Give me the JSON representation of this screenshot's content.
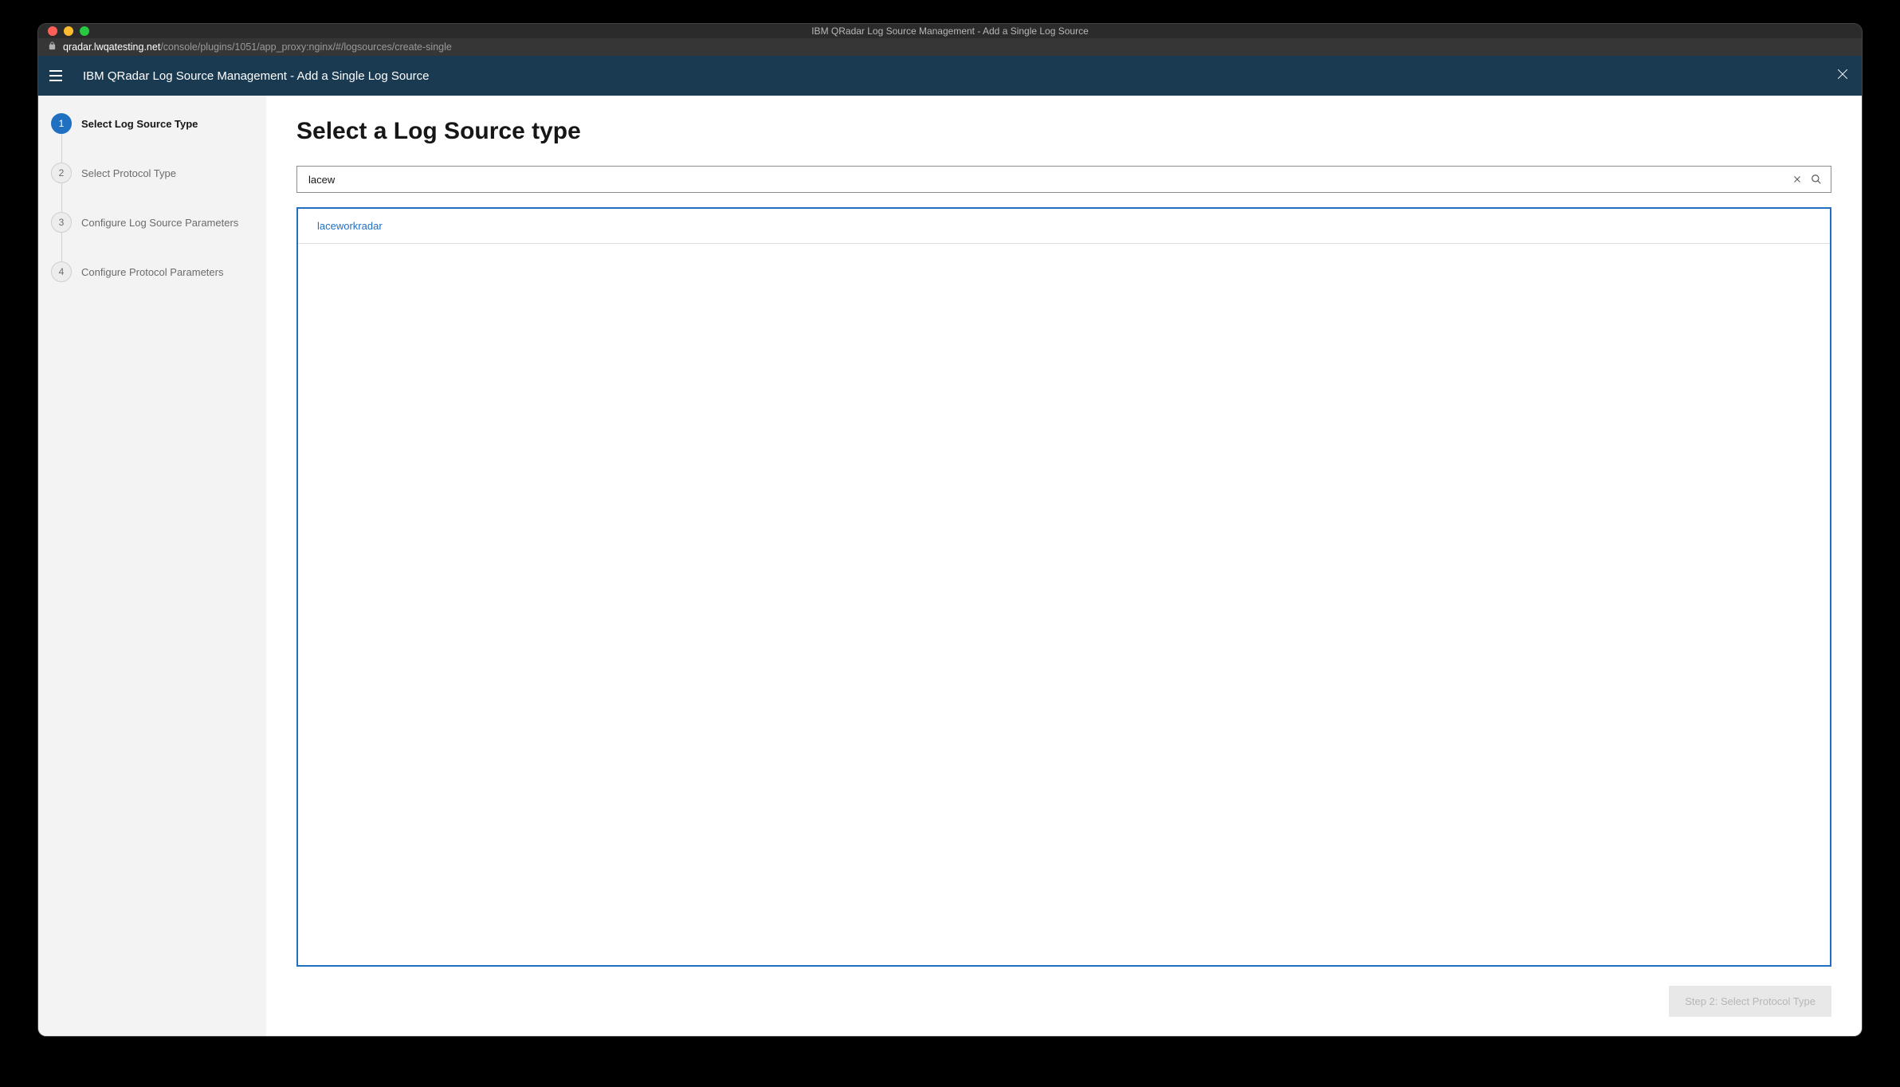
{
  "window": {
    "title": "IBM QRadar Log Source Management - Add a Single Log Source"
  },
  "addressbar": {
    "host": "qradar.lwqatesting.net",
    "path": "/console/plugins/1051/app_proxy:nginx/#/logsources/create-single"
  },
  "header": {
    "app_title": "IBM QRadar Log Source Management - Add a Single Log Source"
  },
  "stepper": {
    "steps": [
      {
        "num": "1",
        "label": "Select Log Source Type"
      },
      {
        "num": "2",
        "label": "Select Protocol Type"
      },
      {
        "num": "3",
        "label": "Configure Log Source Parameters"
      },
      {
        "num": "4",
        "label": "Configure Protocol Parameters"
      }
    ],
    "active_index": 0
  },
  "main": {
    "title": "Select a Log Source type",
    "search_value": "lacew",
    "results": [
      {
        "label": "laceworkradar"
      }
    ],
    "next_button_label": "Step 2: Select Protocol Type"
  }
}
